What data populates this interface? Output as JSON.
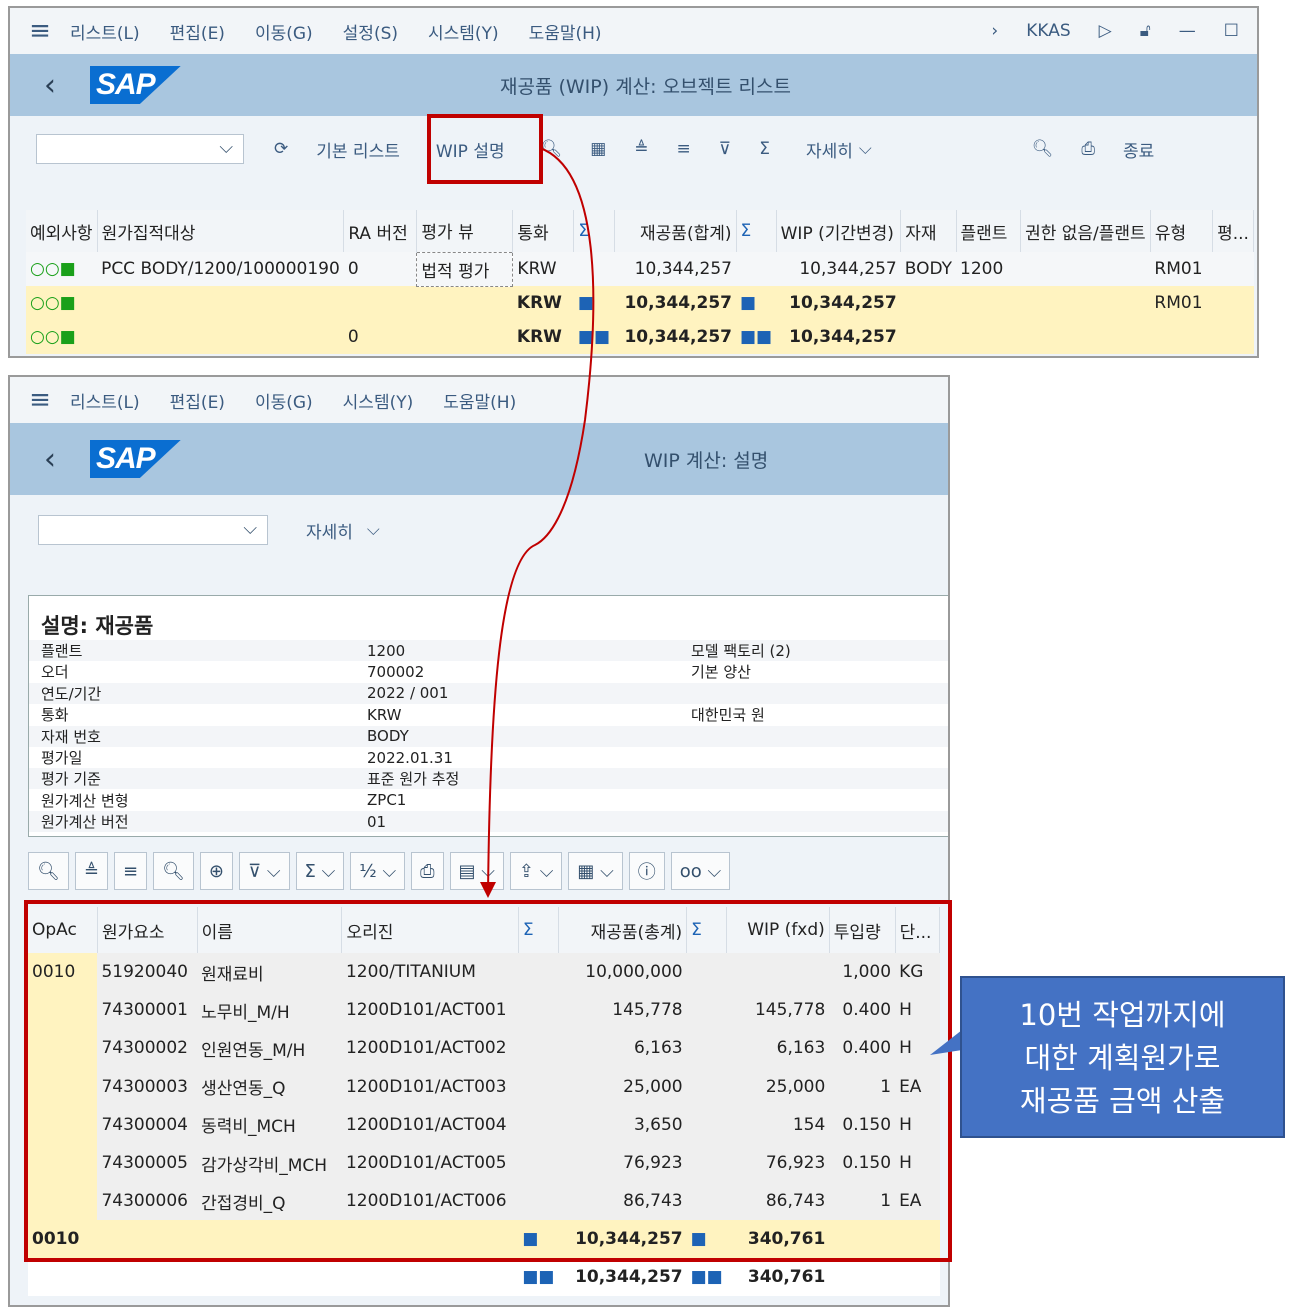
{
  "win1": {
    "menu": [
      "리스트(L)",
      "편집(E)",
      "이동(G)",
      "설정(S)",
      "시스템(Y)",
      "도움말(H)"
    ],
    "user": "KKAS",
    "title": "재공품 (WIP) 계산: 오브젝트 리스트",
    "toolbar": {
      "basic_list": "기본 리스트",
      "wip_desc": "WIP 설명",
      "more": "자세히",
      "exit": "종료"
    },
    "headers": [
      "예외사항",
      "원가집적대상",
      "RA 버전",
      "평가 뷰",
      "통화",
      "Σ",
      "재공품(합계)",
      "Σ",
      "WIP (기간변경)",
      "자재",
      "플랜트",
      "권한 없음/플랜트",
      "유형",
      "평..."
    ],
    "rows": [
      {
        "obj": "PCC BODY/1200/100000190",
        "ra": "0",
        "view": "법적 평가",
        "cur": "KRW",
        "wip": "10,344,257",
        "wipc": "10,344,257",
        "mat": "BODY",
        "plant": "1200",
        "type": "RM01"
      },
      {
        "cur": "KRW",
        "wip": "10,344,257",
        "wipc": "10,344,257",
        "type": "RM01"
      },
      {
        "ra": "0",
        "cur": "KRW",
        "wip": "10,344,257",
        "wipc": "10,344,257"
      }
    ]
  },
  "win2": {
    "menu": [
      "리스트(L)",
      "편집(E)",
      "이동(G)",
      "시스템(Y)",
      "도움말(H)"
    ],
    "title": "WIP 계산: 설명",
    "more": "자세히",
    "desc_title": "설명: 재공품",
    "desc": [
      [
        "플랜트",
        "1200",
        "모델 팩토리 (2)"
      ],
      [
        "오더",
        "700002",
        "기본 양산"
      ],
      [
        "연도/기간",
        "2022 / 001",
        ""
      ],
      [
        "통화",
        "KRW",
        "대한민국 원"
      ],
      [
        "자재 번호",
        "BODY",
        ""
      ],
      [
        "평가일",
        "2022.01.31",
        ""
      ],
      [
        "평가 기준",
        "표준 원가 추정",
        ""
      ],
      [
        "원가계산 변형",
        "ZPC1",
        ""
      ],
      [
        "원가계산 버전",
        "01",
        ""
      ]
    ],
    "headers": [
      "OpAc",
      "원가요소",
      "이름",
      "오리진",
      "Σ",
      "재공품(총계)",
      "Σ",
      "WIP (fxd)",
      "투입량",
      "단..."
    ],
    "rows": [
      [
        "0010",
        "51920040",
        "원재료비",
        "1200/TITANIUM",
        "10,000,000",
        "",
        "1,000",
        "KG"
      ],
      [
        "",
        "74300001",
        "노무비_M/H",
        "1200D101/ACT001",
        "145,778",
        "145,778",
        "0.400",
        "H"
      ],
      [
        "",
        "74300002",
        "인원연동_M/H",
        "1200D101/ACT002",
        "6,163",
        "6,163",
        "0.400",
        "H"
      ],
      [
        "",
        "74300003",
        "생산연동_Q",
        "1200D101/ACT003",
        "25,000",
        "25,000",
        "1",
        "EA"
      ],
      [
        "",
        "74300004",
        "동력비_MCH",
        "1200D101/ACT004",
        "3,650",
        "154",
        "0.150",
        "H"
      ],
      [
        "",
        "74300005",
        "감가상각비_MCH",
        "1200D101/ACT005",
        "76,923",
        "76,923",
        "0.150",
        "H"
      ],
      [
        "",
        "74300006",
        "간접경비_Q",
        "1200D101/ACT006",
        "86,743",
        "86,743",
        "1",
        "EA"
      ]
    ],
    "subtotal": {
      "op": "0010",
      "wip": "10,344,257",
      "fxd": "340,761"
    },
    "total": {
      "wip": "10,344,257",
      "fxd": "340,761"
    }
  },
  "callout": [
    "10번 작업까지에",
    "대한 계획원가로",
    "재공품 금액 산출"
  ]
}
